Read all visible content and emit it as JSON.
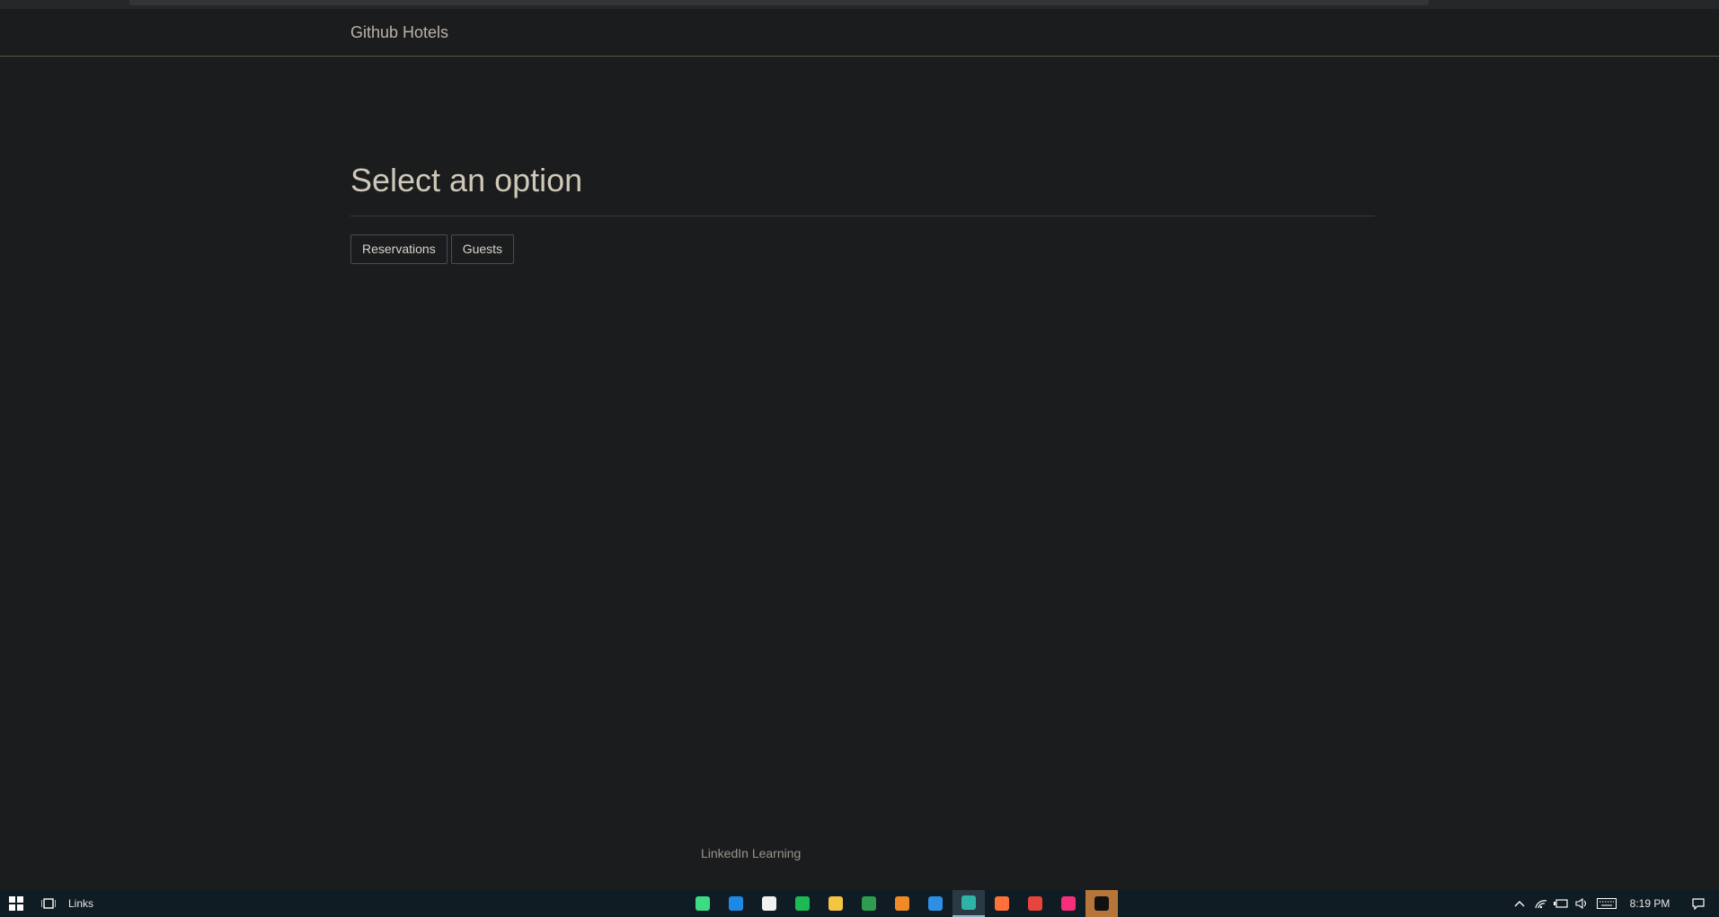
{
  "navbar": {
    "brand": "Github Hotels"
  },
  "main": {
    "title": "Select an option",
    "buttons": [
      {
        "label": "Reservations"
      },
      {
        "label": "Guests"
      }
    ]
  },
  "footer": {
    "text": "LinkedIn Learning"
  },
  "taskbar": {
    "links_label": "Links",
    "clock": "8:19 PM",
    "apps": [
      {
        "icon": "android-studio-icon",
        "color": "#3ddc84"
      },
      {
        "icon": "mail-icon",
        "color": "#1e88e5"
      },
      {
        "icon": "store-icon",
        "color": "#f1f1f1"
      },
      {
        "icon": "spotify-icon",
        "color": "#1db954"
      },
      {
        "icon": "file-explorer-icon",
        "color": "#f4c542"
      },
      {
        "icon": "app-icon",
        "color": "#2e9e4e"
      },
      {
        "icon": "sublime-text-icon",
        "color": "#f08a24"
      },
      {
        "icon": "vscode-icon",
        "color": "#2d8fe6"
      },
      {
        "icon": "edge-icon",
        "color": "#2fb3a6"
      },
      {
        "icon": "firefox-icon",
        "color": "#ff7139"
      },
      {
        "icon": "chrome-icon",
        "color": "#e7443b"
      },
      {
        "icon": "jetbrains-toolbox-icon",
        "color": "#f62e7c"
      },
      {
        "icon": "intellij-icon",
        "color": "#111111"
      }
    ]
  }
}
